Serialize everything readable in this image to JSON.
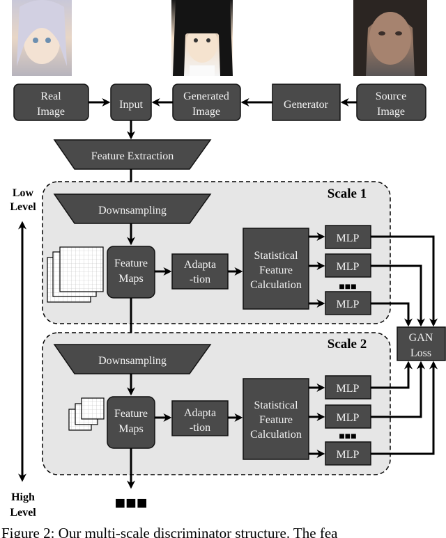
{
  "images": {
    "real": {
      "label": "anime character with silver hair (real image)"
    },
    "generated": {
      "label": "anime character with black hair (generated image)"
    },
    "source": {
      "label": "photo of a human face (source image)"
    }
  },
  "top_row": {
    "real_image": [
      "Real",
      "Image"
    ],
    "input": "Input",
    "generated_image": [
      "Generated",
      "Image"
    ],
    "generator": "Generator",
    "source_image": [
      "Source",
      "Image"
    ]
  },
  "feature_extraction": "Feature Extraction",
  "level_axis": {
    "low": [
      "Low",
      "Level"
    ],
    "high": [
      "High",
      "Level"
    ]
  },
  "scales": [
    {
      "title": "Scale 1",
      "downsampling": "Downsampling",
      "feature_maps": [
        "Feature",
        "Maps"
      ],
      "adaptation": [
        "Adapta",
        "-tion"
      ],
      "statistical": [
        "Statistical",
        "Feature",
        "Calculation"
      ],
      "mlps": [
        "MLP",
        "MLP",
        "MLP"
      ],
      "ellipsis": "■■■"
    },
    {
      "title": "Scale 2",
      "downsampling": "Downsampling",
      "feature_maps": [
        "Feature",
        "Maps"
      ],
      "adaptation": [
        "Adapta",
        "-tion"
      ],
      "statistical": [
        "Statistical",
        "Feature",
        "Calculation"
      ],
      "mlps": [
        "MLP",
        "MLP",
        "MLP"
      ],
      "ellipsis": "■■■"
    }
  ],
  "gan_loss": [
    "GAN",
    "Loss"
  ],
  "bottom_ellipsis": "■■■",
  "caption": "Figure 2: Our multi-scale discriminator structure. The fea"
}
